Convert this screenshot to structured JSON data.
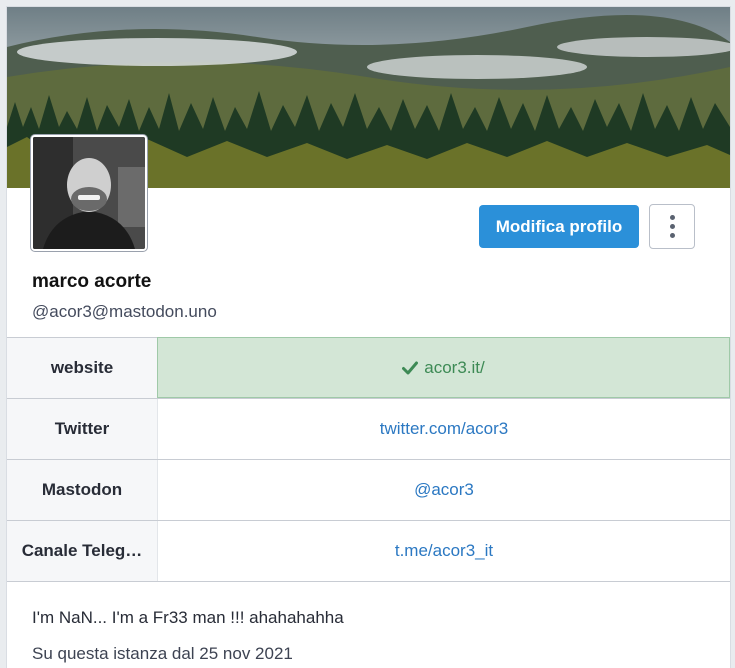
{
  "profile": {
    "display_name": "marco acorte",
    "handle": "@acor3@mastodon.uno",
    "edit_button_label": "Modifica profilo",
    "more_icon": "kebab-vertical-icon",
    "header_image": "forest-mountains-photo",
    "avatar_image": "profile-photo"
  },
  "fields": [
    {
      "key": "website",
      "value": "acor3.it/",
      "verified": true,
      "verified_icon": "check-icon"
    },
    {
      "key": "Twitter",
      "value": "twitter.com/acor3",
      "verified": false
    },
    {
      "key": "Mastodon",
      "value": "@acor3",
      "verified": false
    },
    {
      "key": "Canale Teleg…",
      "value": "t.me/acor3_it",
      "verified": false
    }
  ],
  "bio": "I'm NaN... I'm a Fr33 man !!! ahahahahha",
  "joined": "Su questa istanza dal 25 nov 2021",
  "colors": {
    "accent": "#2b90d9",
    "verified_bg": "#d3e6d6",
    "verified_text": "#3d8a55",
    "link": "#2b78c2"
  }
}
